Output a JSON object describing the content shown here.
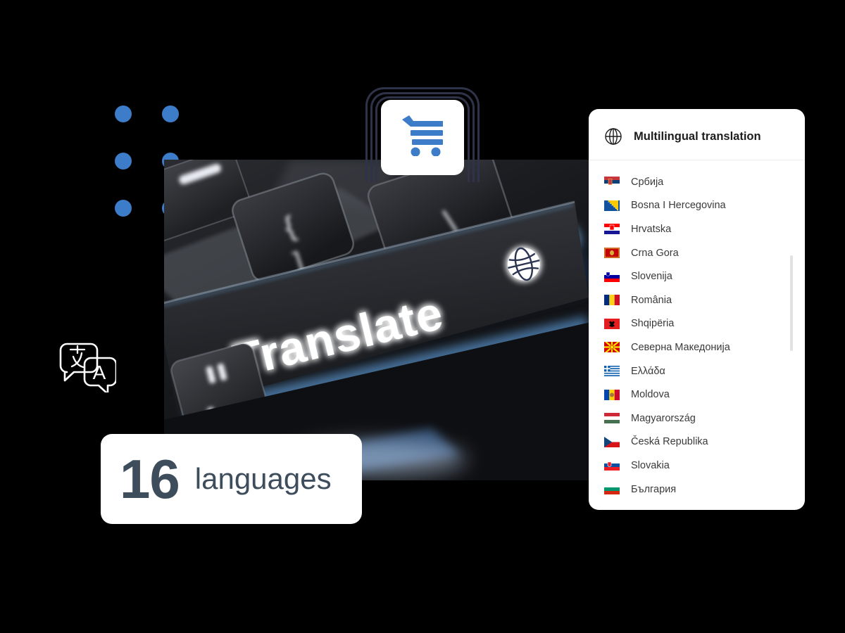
{
  "colors": {
    "background": "#000000",
    "accent_blue": "#3d7cc9",
    "purple": "#bb44cc",
    "navy": "#2f3349",
    "slate_text": "#3d4d5c",
    "card_white": "#ffffff",
    "list_text": "#3a3a3a",
    "divider": "#ececec",
    "scrollbar": "#e2e2e2"
  },
  "dot_grid": {
    "icon": "dot-grid-decoration",
    "columns": 2,
    "rows": 3,
    "color": "#3d7cc9"
  },
  "cart_card": {
    "icon": "shopping-cart-icon",
    "icon_color": "#3d7cc9"
  },
  "translate_badge": {
    "icon": "translate-icon",
    "circle_color": "#bb44cc",
    "glyphs": [
      "文",
      "A"
    ]
  },
  "keyboard_image": {
    "name": "translate-key-photo",
    "key_label": "Translate",
    "key_icon": "globe-icon",
    "alt": "Close-up photo of a backlit keyboard with a glowing Translate key"
  },
  "count_card": {
    "number": "16",
    "label": "languages"
  },
  "panel": {
    "header": {
      "icon": "globe-icon",
      "title": "Multilingual translation"
    },
    "languages": [
      {
        "label": "Србија",
        "flag": "rs"
      },
      {
        "label": "Bosna I Hercegovina",
        "flag": "ba"
      },
      {
        "label": "Hrvatska",
        "flag": "hr"
      },
      {
        "label": "Crna Gora",
        "flag": "me"
      },
      {
        "label": "Slovenija",
        "flag": "si"
      },
      {
        "label": "România",
        "flag": "ro"
      },
      {
        "label": "Shqipëria",
        "flag": "al"
      },
      {
        "label": "Северна Македонија",
        "flag": "mk"
      },
      {
        "label": "Ελλάδα",
        "flag": "gr"
      },
      {
        "label": "Moldova",
        "flag": "md"
      },
      {
        "label": "Magyarország",
        "flag": "hu"
      },
      {
        "label": "Česká Republika",
        "flag": "cz"
      },
      {
        "label": "Slovakia",
        "flag": "sk"
      },
      {
        "label": "България",
        "flag": "bg"
      }
    ],
    "scrollbar": {
      "name": "panel-scrollbar"
    }
  }
}
